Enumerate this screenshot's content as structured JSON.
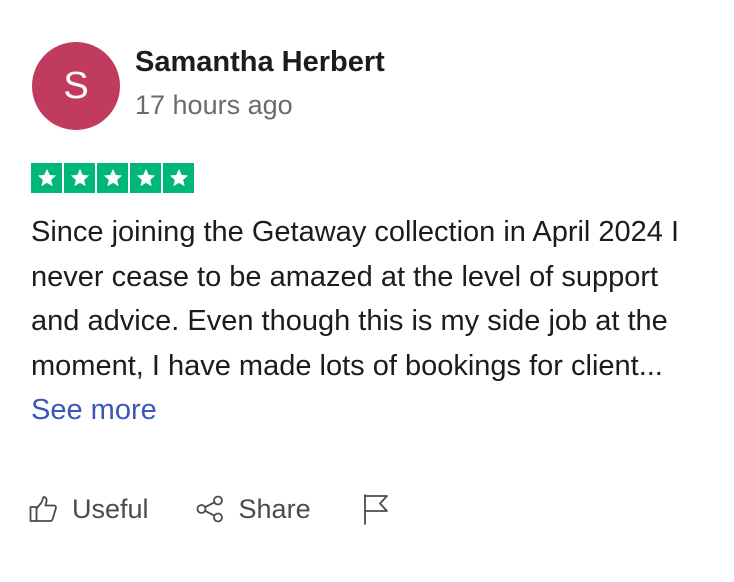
{
  "review": {
    "author": {
      "initial": "S",
      "name": "Samantha Herbert",
      "avatar_color": "#c13b5f"
    },
    "time_ago": "17 hours ago",
    "rating": {
      "stars": 5,
      "max": 5,
      "color": "#00b67a",
      "icon": "star-icon"
    },
    "text": "Since joining the Getaway collection in April 2024 I never cease to be amazed at the level of support and advice. Even though this is my side job at the moment, I have made lots of bookings for client...",
    "see_more_label": "See more",
    "link_color": "#3c57bc"
  },
  "actions": {
    "useful_label": "Useful",
    "useful_icon": "thumbs-up-icon",
    "share_label": "Share",
    "share_icon": "share-icon",
    "report_icon": "flag-icon"
  }
}
